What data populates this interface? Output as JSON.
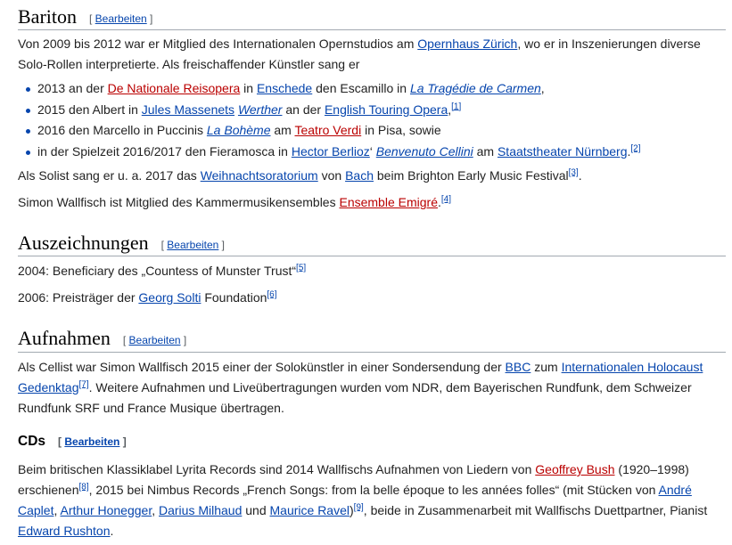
{
  "edit_label": "Bearbeiten",
  "bariton": {
    "heading": "Bariton",
    "p1": [
      "Von 2009 bis 2012 war er Mitglied des Internationalen Opernstudios am ",
      "Opernhaus Zürich",
      ", wo er in Inszenierungen diverse Solo-Rollen interpretierte. Als freischaffender Künstler sang er"
    ],
    "items": [
      [
        "2013 an der ",
        "De Nationale Reisopera",
        " in ",
        "Enschede",
        " den Escamillo in ",
        "La Tragédie de Carmen",
        ","
      ],
      [
        "2015 den Albert in ",
        "Jules Massenets",
        " ",
        "Werther",
        " an der ",
        "English Touring Opera",
        ",",
        "[1]"
      ],
      [
        "2016 den Marcello in Puccinis ",
        "La Bohème",
        " am ",
        "Teatro Verdi",
        " in Pisa, sowie"
      ],
      [
        "in der Spielzeit 2016/2017 den Fieramosca in ",
        "Hector Berlioz",
        "‘ ",
        "Benvenuto Cellini",
        " am ",
        "Staatstheater Nürnberg",
        ".",
        "[2]"
      ]
    ],
    "p2": [
      "Als Solist sang er u. a. 2017 das ",
      "Weihnachtsoratorium",
      " von ",
      "Bach",
      " beim Brighton Early Music Festival",
      "[3]",
      "."
    ],
    "p3": [
      "Simon Wallfisch ist Mitglied des Kammermusikensembles ",
      "Ensemble Emigré",
      ".",
      "[4]"
    ]
  },
  "auszeichnungen": {
    "heading": "Auszeichnungen",
    "p1": [
      "2004: Beneficiary des „Countess of Munster Trust“",
      "[5]"
    ],
    "p2": [
      "2006: Preisträger der ",
      "Georg Solti",
      " Foundation",
      "[6]"
    ]
  },
  "aufnahmen": {
    "heading": "Aufnahmen",
    "p1": [
      "Als Cellist war Simon Wallfisch 2015 einer der Solokünstler in einer Sondersendung der ",
      "BBC",
      " zum ",
      "Internationalen Holocaust Gedenktag",
      "[7]",
      ". Weitere Aufnahmen und Liveübertragungen wurden vom NDR, dem Bayerischen Rundfunk, dem Schweizer Rundfunk SRF und France Musique übertragen."
    ]
  },
  "cds": {
    "heading": "CDs",
    "p1": [
      "Beim britischen Klassiklabel Lyrita Records sind 2014 Wallfischs Aufnahmen von Liedern von ",
      "Geoffrey Bush",
      " (1920–1998) erschienen",
      "[8]",
      ", 2015 bei Nimbus Records „French Songs: from la belle époque to les années folles“ (mit Stücken von ",
      "André Caplet",
      ", ",
      "Arthur Honegger",
      ", ",
      "Darius Milhaud",
      " und ",
      "Maurice Ravel",
      ")",
      "[9]",
      ", beide in Zusammenarbeit mit Wallfischs Duettpartner, Pianist ",
      "Edward Rushton",
      "."
    ]
  }
}
